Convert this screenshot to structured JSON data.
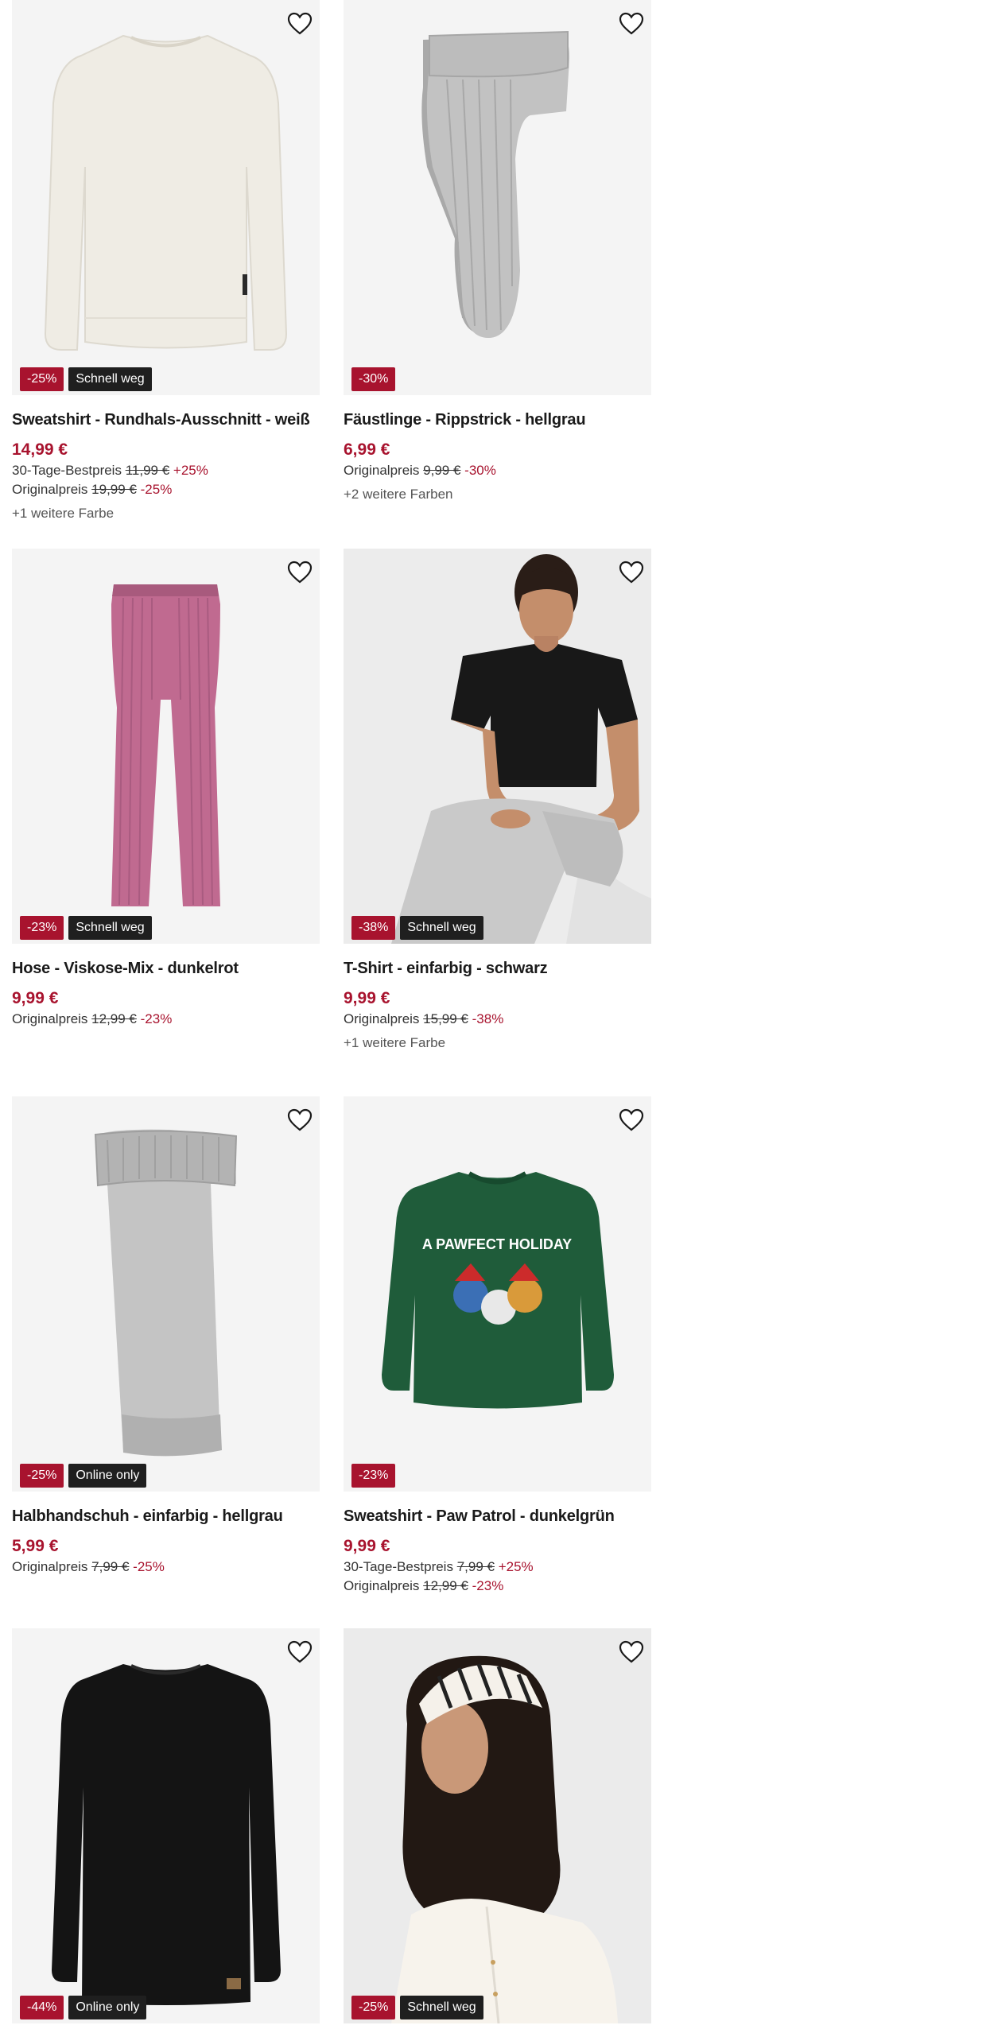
{
  "colors": {
    "sale_badge": "#a8132e",
    "info_badge": "#1f1f1f",
    "price": "#a8132e",
    "image_bg": "#f4f4f4"
  },
  "products": [
    {
      "title": "Sweatshirt - Rundhals-Ausschnitt - weiß",
      "price": "14,99 €",
      "image": "white-sweatshirt",
      "badges": {
        "discount": "-25%",
        "tag": "Schnell weg"
      },
      "best_price": {
        "label": "30-Tage-Bestpreis",
        "value": "11,99 €",
        "pct": "+25%"
      },
      "original": {
        "label": "Originalpreis",
        "value": "19,99 €",
        "pct": "-25%"
      },
      "more_colors": "+1 weitere Farbe"
    },
    {
      "title": "Fäustlinge - Rippstrick - hellgrau",
      "price": "6,99 €",
      "image": "grey-mittens",
      "badges": {
        "discount": "-30%"
      },
      "original": {
        "label": "Originalpreis",
        "value": "9,99 €",
        "pct": "-30%"
      },
      "more_colors": "+2 weitere Farben"
    },
    {
      "title": "Hose - Viskose-Mix - dunkelrot",
      "price": "9,99 €",
      "image": "pink-ribbed-pants",
      "badges": {
        "discount": "-23%",
        "tag": "Schnell weg"
      },
      "original": {
        "label": "Originalpreis",
        "value": "12,99 €",
        "pct": "-23%"
      }
    },
    {
      "title": "T-Shirt - einfarbig - schwarz",
      "price": "9,99 €",
      "image": "model-black-tshirt",
      "badges": {
        "discount": "-38%",
        "tag": "Schnell weg"
      },
      "original": {
        "label": "Originalpreis",
        "value": "15,99 €",
        "pct": "-38%"
      },
      "more_colors": "+1 weitere Farbe"
    },
    {
      "title": "Halbhandschuh - einfarbig - hellgrau",
      "price": "5,99 €",
      "image": "grey-arm-warmer",
      "badges": {
        "discount": "-25%",
        "tag": "Online only"
      },
      "original": {
        "label": "Originalpreis",
        "value": "7,99 €",
        "pct": "-25%"
      }
    },
    {
      "title": "Sweatshirt - Paw Patrol - dunkelgrün",
      "price": "9,99 €",
      "image": "green-paw-patrol-sweatshirt",
      "print_text": "A PAWFECT HOLIDAY",
      "badges": {
        "discount": "-23%"
      },
      "best_price": {
        "label": "30-Tage-Bestpreis",
        "value": "7,99 €",
        "pct": "+25%"
      },
      "original": {
        "label": "Originalpreis",
        "value": "12,99 €",
        "pct": "-23%"
      }
    },
    {
      "image": "black-longsleeve",
      "badges": {
        "discount": "-44%",
        "tag": "Online only"
      }
    },
    {
      "image": "model-headscarf",
      "badges": {
        "discount": "-25%",
        "tag": "Schnell weg"
      }
    }
  ]
}
